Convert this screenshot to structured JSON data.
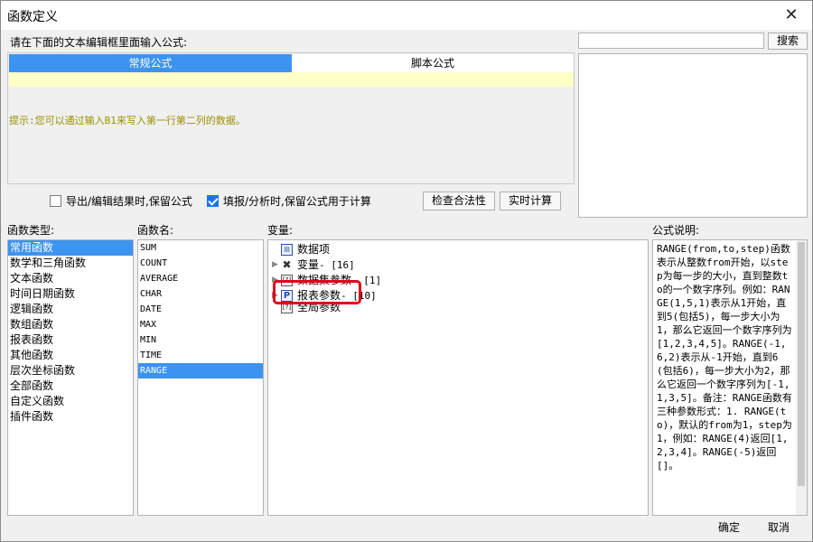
{
  "window": {
    "title": "函数定义",
    "close_icon": "close-icon",
    "close_glyph": "✕"
  },
  "editor": {
    "prompt": "请在下面的文本编辑框里面输入公式:",
    "tabs": [
      {
        "label": "常规公式",
        "active": true
      },
      {
        "label": "脚本公式",
        "active": false
      }
    ],
    "formula_value": "",
    "hint": "提示:您可以通过输入B1来写入第一行第二列的数据。"
  },
  "search": {
    "value": "",
    "button_label": "搜索"
  },
  "options": {
    "keep_formula_export": {
      "label": "导出/编辑结果时,保留公式",
      "checked": false
    },
    "keep_formula_fill": {
      "label": "填报/分析时,保留公式用于计算",
      "checked": true
    },
    "validate_label": "检查合法性",
    "realtime_label": "实时计算"
  },
  "sections": {
    "types_label": "函数类型:",
    "names_label": "函数名:",
    "vars_label": "变量:",
    "desc_label": "公式说明:"
  },
  "function_types": [
    "常用函数",
    "数学和三角函数",
    "文本函数",
    "时间日期函数",
    "逻辑函数",
    "数组函数",
    "报表函数",
    "其他函数",
    "层次坐标函数",
    "全部函数",
    "自定义函数",
    "插件函数"
  ],
  "function_types_selected": 0,
  "function_names": [
    "SUM",
    "COUNT",
    "AVERAGE",
    "CHAR",
    "DATE",
    "MAX",
    "MIN",
    "TIME",
    "RANGE"
  ],
  "function_names_selected": 8,
  "variables": [
    {
      "label": "数据项",
      "suffix": "",
      "icon": "data-item-icon",
      "glyph": "▤",
      "expandable": false
    },
    {
      "label": "变量",
      "suffix": " - [16]",
      "icon": "variable-icon",
      "glyph": "✖",
      "expandable": true
    },
    {
      "label": "数据集参数",
      "suffix": " - [1]",
      "icon": "dataset-param-icon",
      "glyph": "[?]",
      "expandable": true
    },
    {
      "label": "报表参数",
      "suffix": " - [10]",
      "icon": "report-param-icon",
      "glyph": "P",
      "expandable": true
    },
    {
      "label": "全局参数",
      "suffix": "",
      "icon": "global-param-icon",
      "glyph": "[?]",
      "expandable": false
    }
  ],
  "description": "RANGE(from,to,step)函数表示从整数from开始，以step为每一步的大小，直到整数to的一个数字序列。例如：RANGE(1,5,1)表示从1开始，直到5(包括5)，每一步大小为1，那么它返回一个数字序列为[1,2,3,4,5]。RANGE(-1,6,2)表示从-1开始，直到6(包括6)，每一步大小为2，那么它返回一个数字序列为[-1,1,3,5]。备注：RANGE函数有三种参数形式：1. RANGE(to)，默认的from为1，step为1，例如：RANGE(4)返回[1,2,3,4]。RANGE(-5)返回[]。",
  "footer": {
    "ok_label": "确定",
    "cancel_label": "取消"
  },
  "colors": {
    "accent": "#3d93f0",
    "highlight_border": "#e0001c",
    "hint_text": "#9a9000",
    "edit_strip": "#ffffc8"
  }
}
